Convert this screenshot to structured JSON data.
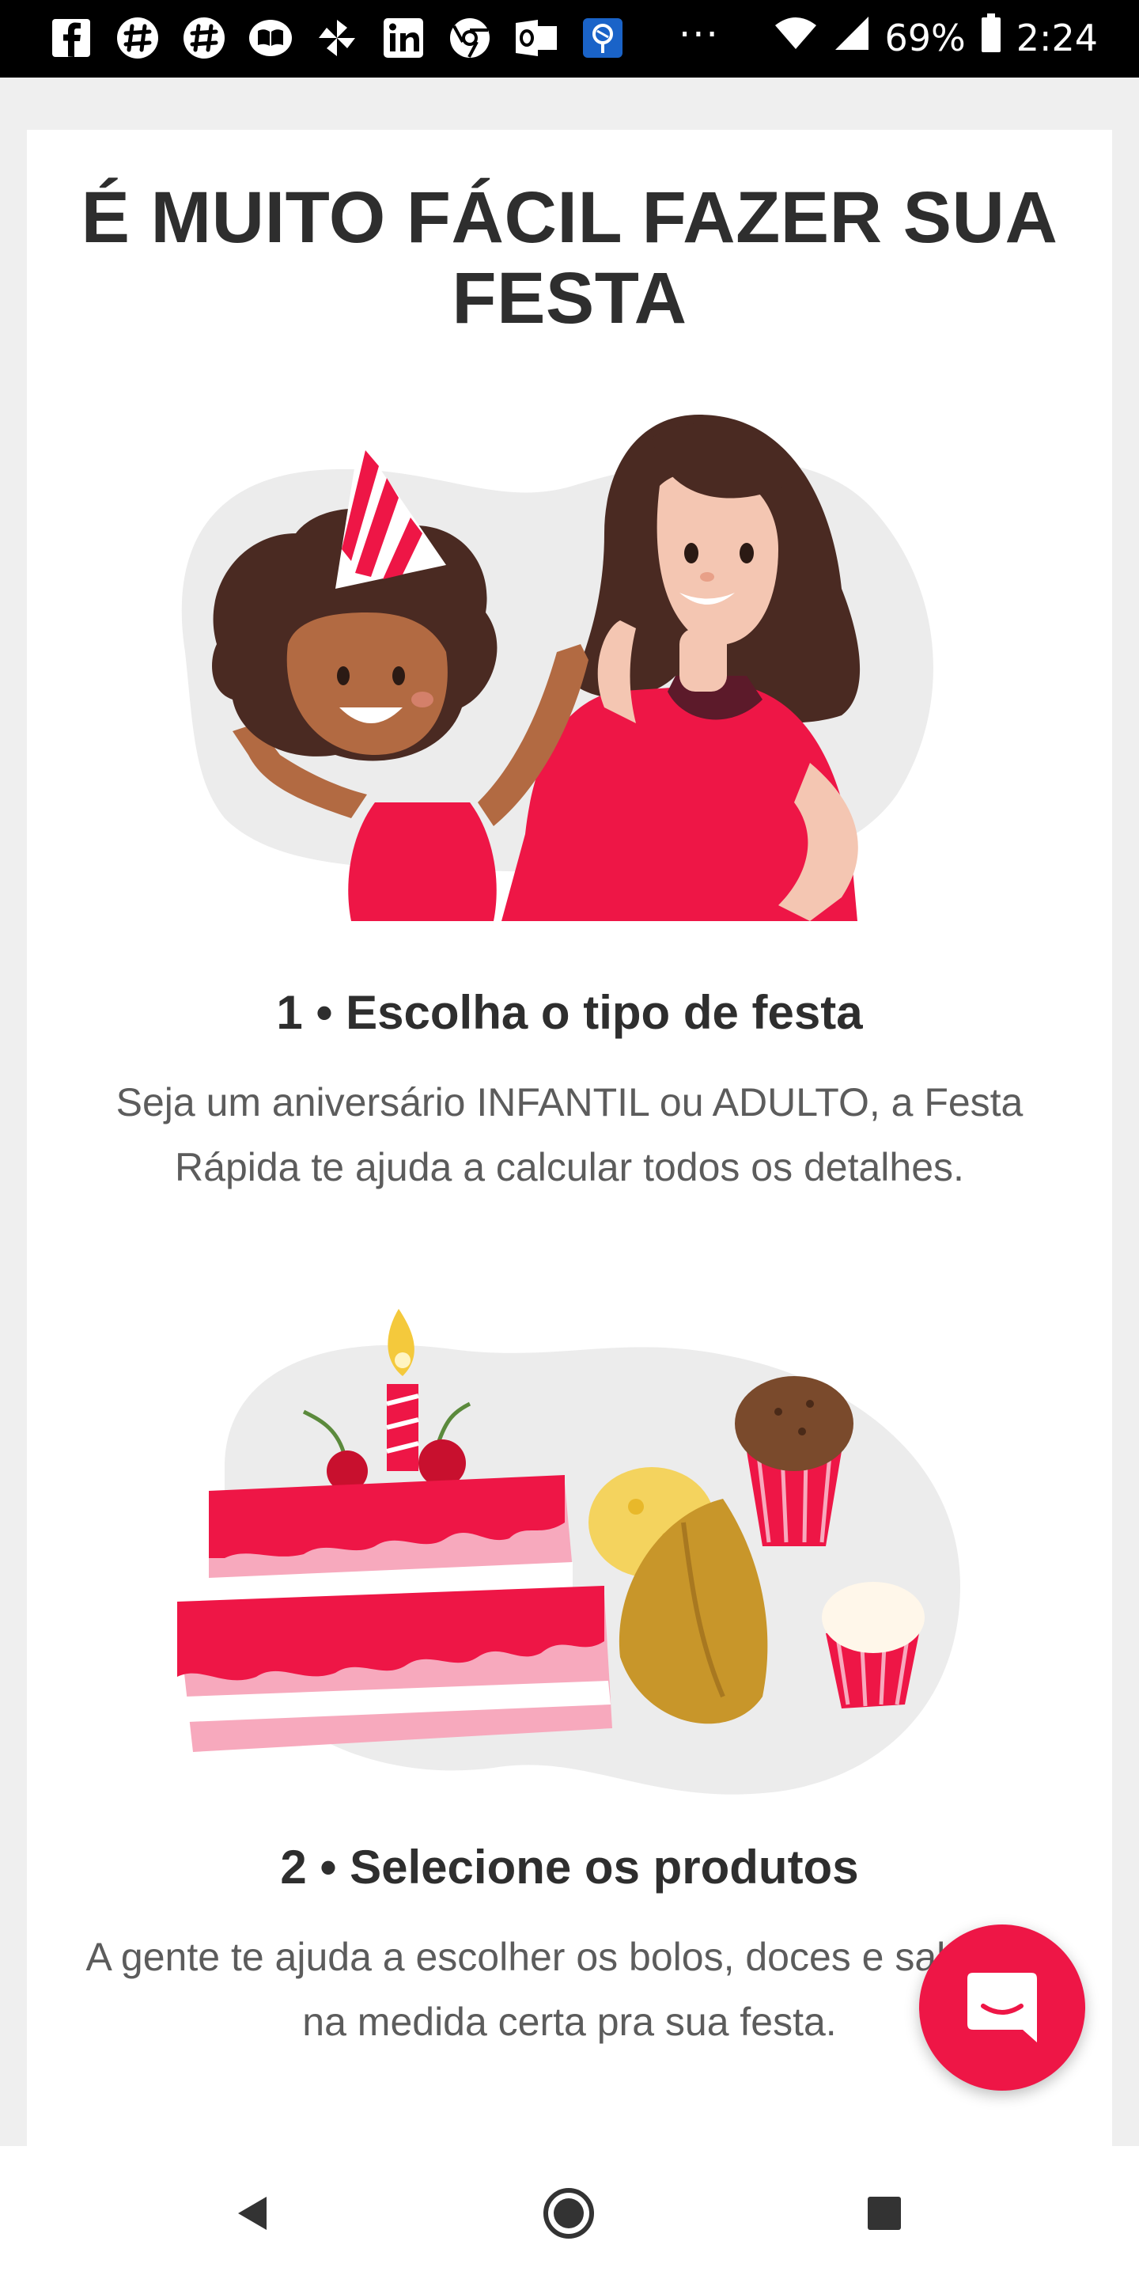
{
  "status_bar": {
    "app_icons": [
      "facebook-icon",
      "slack-icon",
      "slack-icon",
      "books-icon",
      "pinwheel-icon",
      "linkedin-icon",
      "chrome-icon",
      "outlook-icon",
      "location-app-icon"
    ],
    "more": "···",
    "battery": "69%",
    "time": "2:24"
  },
  "page": {
    "title": "É MUITO FÁCIL FAZER SUA FESTA"
  },
  "steps": [
    {
      "title": "1 • Escolha o tipo de festa",
      "description": "Seja um aniversário INFANTIL ou ADULTO, a Festa Rápida te ajuda a calcular todos os detalhes."
    },
    {
      "title": "2 • Selecione os produtos",
      "description": "A gente te ajuda a escolher os bolos, doces e salgados na medida certa pra sua festa."
    }
  ],
  "colors": {
    "accent": "#ee1646",
    "text_dark": "#2e2e2e",
    "text_body": "#5c5c5c",
    "blob": "#ececec"
  },
  "chat_button": {
    "icon": "chat-icon"
  },
  "nav": {
    "icons": [
      "back-icon",
      "home-icon",
      "recents-icon"
    ]
  }
}
